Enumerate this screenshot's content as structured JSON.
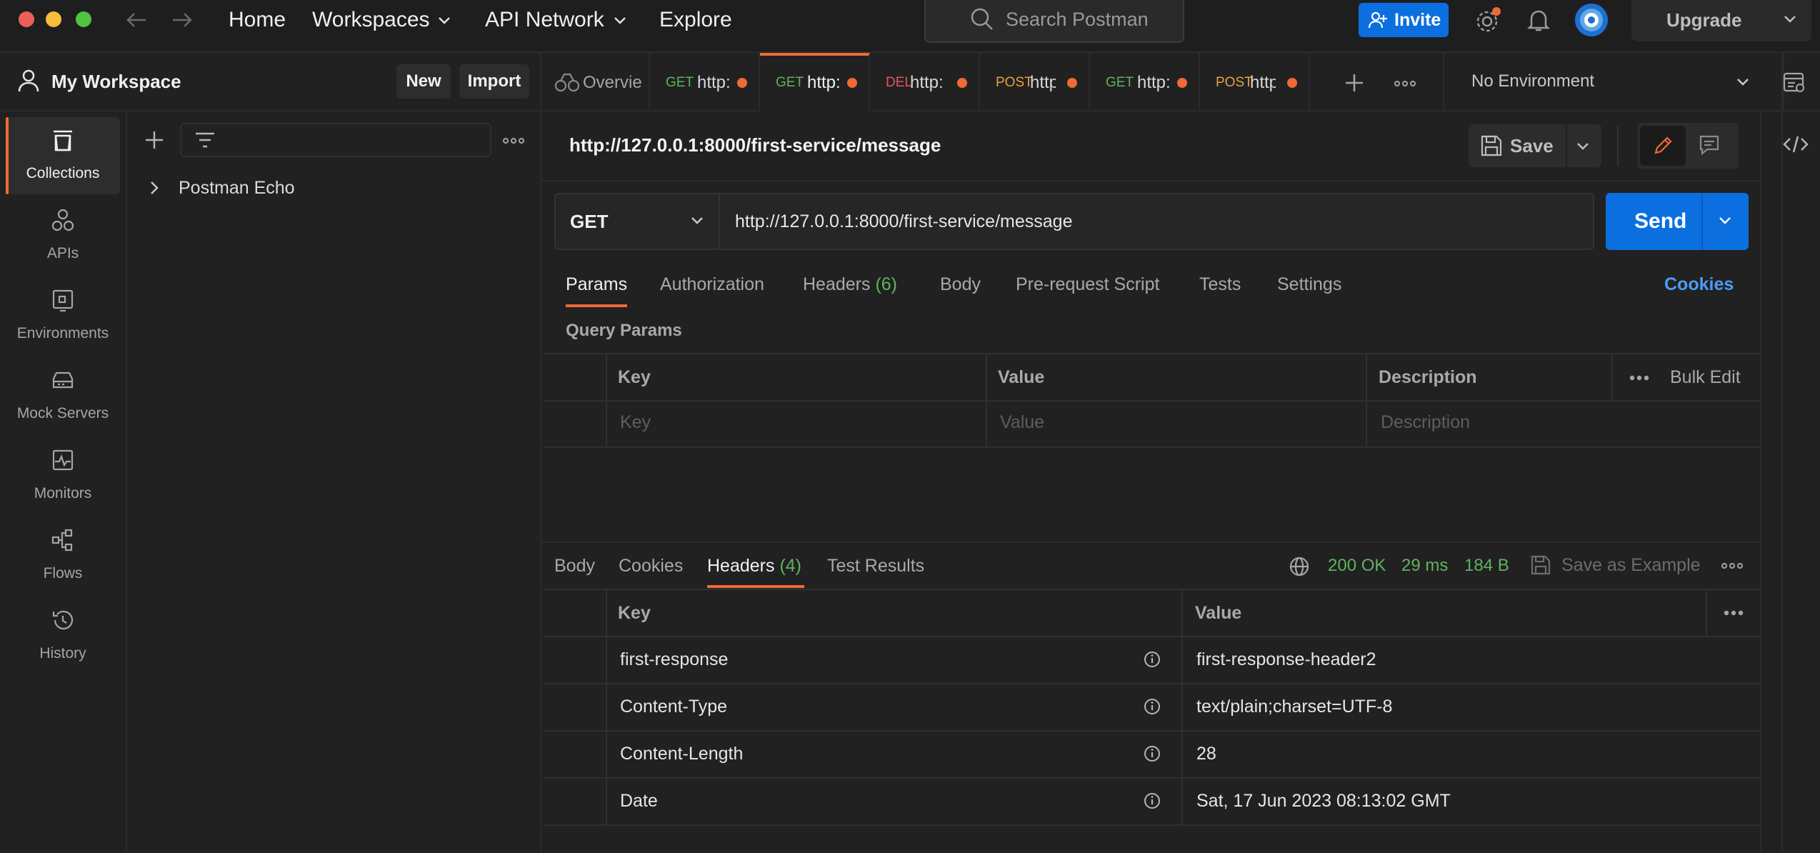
{
  "nav": {
    "home": "Home",
    "workspaces": "Workspaces",
    "api_network": "API Network",
    "explore": "Explore",
    "search_placeholder": "Search Postman",
    "invite": "Invite",
    "upgrade": "Upgrade"
  },
  "workspace": {
    "title": "My Workspace",
    "new_button": "New",
    "import_button": "Import"
  },
  "tabs": [
    {
      "method": "",
      "label": "Overvie",
      "icon": "overview-icon"
    },
    {
      "method": "GET",
      "label": "http:",
      "active": false
    },
    {
      "method": "GET",
      "label": "http:",
      "active": true
    },
    {
      "method": "DEL",
      "label": "http:",
      "active": false
    },
    {
      "method": "POST",
      "label": "http",
      "active": false
    },
    {
      "method": "GET",
      "label": "http:",
      "active": false
    },
    {
      "method": "POST",
      "label": "http",
      "active": false
    }
  ],
  "environment": "No Environment",
  "rail": [
    {
      "label": "Collections",
      "icon": "collections-icon",
      "active": true
    },
    {
      "label": "APIs",
      "icon": "apis-icon"
    },
    {
      "label": "Environments",
      "icon": "environments-icon"
    },
    {
      "label": "Mock Servers",
      "icon": "mock-servers-icon"
    },
    {
      "label": "Monitors",
      "icon": "monitors-icon"
    },
    {
      "label": "Flows",
      "icon": "flows-icon"
    },
    {
      "label": "History",
      "icon": "history-icon"
    }
  ],
  "collections": [
    {
      "name": "Postman Echo"
    }
  ],
  "request": {
    "title": "http://127.0.0.1:8000/first-service/message",
    "save": "Save",
    "method": "GET",
    "url": "http://127.0.0.1:8000/first-service/message",
    "send": "Send",
    "tabs": {
      "params": "Params",
      "authorization": "Authorization",
      "headers": "Headers",
      "headers_count": "(6)",
      "body": "Body",
      "pre_request": "Pre-request Script",
      "tests": "Tests",
      "settings": "Settings",
      "cookies": "Cookies"
    },
    "query_params": {
      "label": "Query Params",
      "columns": [
        "Key",
        "Value",
        "Description"
      ],
      "bulk_edit": "Bulk Edit",
      "placeholders": [
        "Key",
        "Value",
        "Description"
      ]
    }
  },
  "response": {
    "tabs": {
      "body": "Body",
      "cookies": "Cookies",
      "headers": "Headers",
      "headers_count": "(4)",
      "test_results": "Test Results"
    },
    "status": "200 OK",
    "time": "29 ms",
    "size": "184 B",
    "save_as_example": "Save as Example",
    "columns": [
      "Key",
      "Value"
    ],
    "headers": [
      {
        "key": "first-response",
        "value": "first-response-header2"
      },
      {
        "key": "Content-Type",
        "value": "text/plain;charset=UTF-8"
      },
      {
        "key": "Content-Length",
        "value": "28"
      },
      {
        "key": "Date",
        "value": "Sat, 17 Jun 2023 08:13:02 GMT"
      }
    ]
  },
  "colors": {
    "accent": "#ee6a36",
    "primary": "#0b6fe0",
    "get": "#5fb35f",
    "post": "#e6a33d",
    "delete": "#e2555c",
    "link": "#4a9cf5"
  }
}
